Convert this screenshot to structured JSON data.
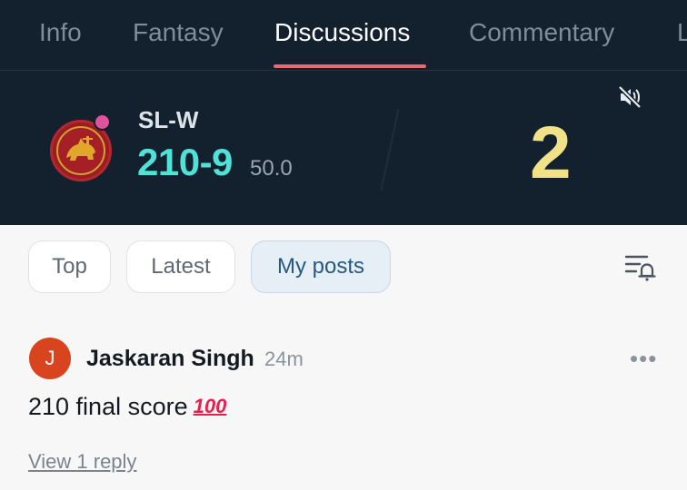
{
  "tabs": [
    {
      "label": "Info"
    },
    {
      "label": "Fantasy"
    },
    {
      "label": "Discussions",
      "active": true
    },
    {
      "label": "Commentary"
    },
    {
      "label": "L"
    }
  ],
  "score": {
    "team": "SL-W",
    "runs": "210-9",
    "overs": "50.0",
    "big_number": "2"
  },
  "filters": [
    {
      "label": "Top"
    },
    {
      "label": "Latest"
    },
    {
      "label": "My posts",
      "active": true
    }
  ],
  "post": {
    "avatar_initial": "J",
    "author": "Jaskaran Singh",
    "time": "24m",
    "text": "210 final score",
    "emoji": "100",
    "reply_link": "View 1 reply"
  },
  "colors": {
    "header_bg": "#13202e",
    "accent": "#e96a6a",
    "runs": "#4fe3d8",
    "big_number": "#f1e187",
    "avatar": "#d8441e"
  },
  "icons": [
    "mute-icon",
    "filter-notify-icon",
    "more-icon",
    "team-logo-icon"
  ]
}
